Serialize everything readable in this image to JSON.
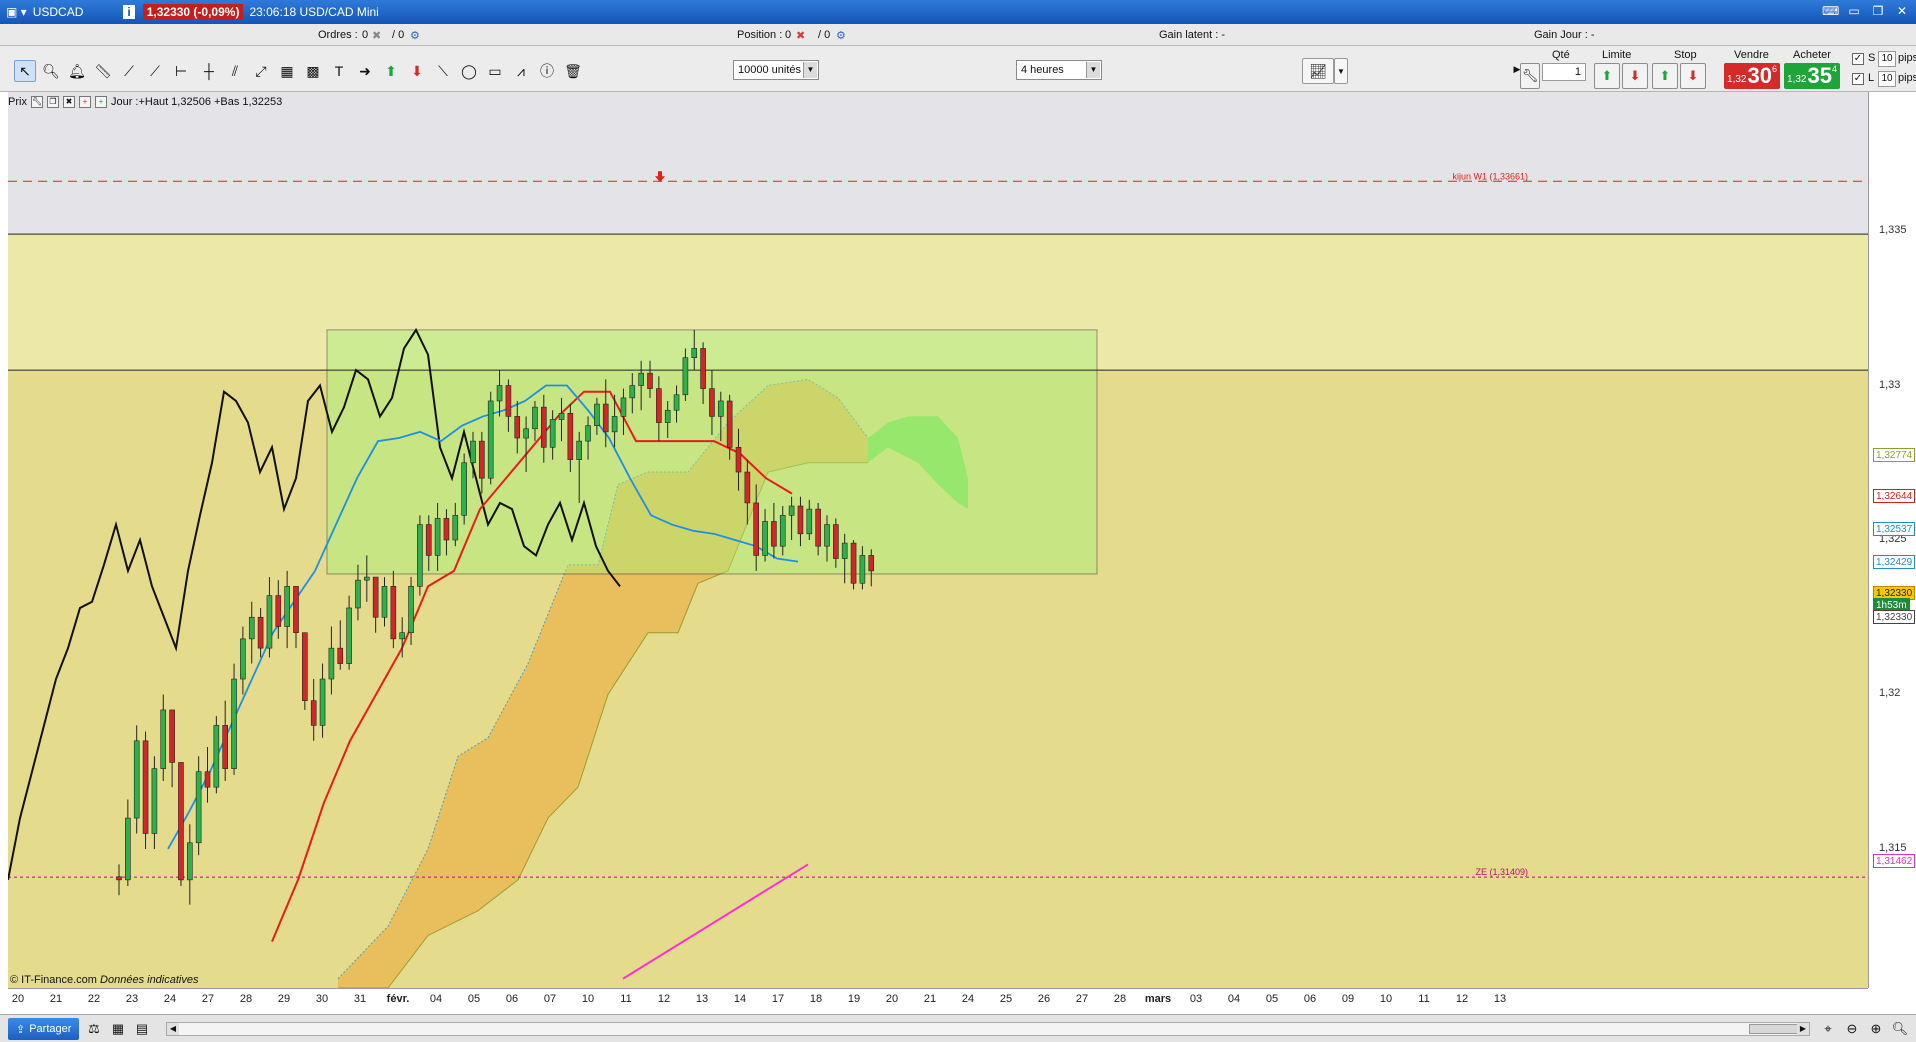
{
  "window": {
    "symbol": "USDCAD",
    "info_icon": "i",
    "price_change": "1,32330 (-0,09%)",
    "time_title": "23:06:18 USD/CAD Mini"
  },
  "infobar": {
    "ordres_label": "Ordres :",
    "ordres_value": "0",
    "ordres_total": "/ 0",
    "position_label": "Position :",
    "position_value": "0",
    "position_total": "/ 0",
    "gain_latent": "Gain latent : -",
    "gain_jour": "Gain Jour : -"
  },
  "toolbar": {
    "units_select": "10000 unités",
    "period_select": "4 heures"
  },
  "trade": {
    "qte_label": "Qté",
    "qte_value": "1",
    "limite_label": "Limite",
    "stop_label": "Stop",
    "vendre_label": "Vendre",
    "acheter_label": "Acheter",
    "sell_small": "1,32",
    "sell_big": "30",
    "sell_sup": "6",
    "buy_small": "1,32",
    "buy_big": "35",
    "buy_sup": "4",
    "s_label": "S",
    "l_label": "L",
    "s_pips_value": "10",
    "l_pips_value": "10",
    "pips_label": "pips",
    "sell_color": "#d42a2a",
    "buy_color": "#1ea53a"
  },
  "legend": {
    "prix": "Prix",
    "jour": "Jour :+Haut 1,32506 +Bas 1,32253"
  },
  "copyright": "© IT-Finance.com",
  "copyright_note": "Données indicatives",
  "annotations": {
    "kijun": "kijun W1 (1,33661)",
    "ze": "ZE (1,31409)"
  },
  "price_axis": {
    "ticks": [
      "1,335",
      "1,33",
      "1,325",
      "1,32",
      "1,315"
    ],
    "labels": [
      {
        "text": "1,32774",
        "color": "#8aa030"
      },
      {
        "text": "1,32644",
        "color": "#d42020"
      },
      {
        "text": "1,32537",
        "color": "#1e90d0"
      },
      {
        "text": "1,32429",
        "color": "#1e90d0"
      },
      {
        "text": "1,32330",
        "color": "#c08a00"
      },
      {
        "text": "1h53m",
        "color": "#1e8a3a"
      },
      {
        "text": "1,32330",
        "color": "#444444"
      },
      {
        "text": "1,31462",
        "color": "#e030c0"
      }
    ]
  },
  "date_axis": {
    "ticks": [
      "20",
      "21",
      "22",
      "23",
      "24",
      "27",
      "28",
      "29",
      "30",
      "31",
      "févr.",
      "04",
      "05",
      "06",
      "07",
      "10",
      "11",
      "12",
      "13",
      "14",
      "17",
      "18",
      "19",
      "20",
      "21",
      "24",
      "25",
      "26",
      "27",
      "28",
      "mars",
      "03",
      "04",
      "05",
      "06",
      "09",
      "10",
      "11",
      "12",
      "13"
    ]
  },
  "bottombar": {
    "share": "Partager"
  },
  "chart_data": {
    "type": "candlestick",
    "instrument": "USD/CAD",
    "timeframe": "4 heures",
    "ylim": [
      1.3105,
      1.3395
    ],
    "price_ticks": [
      1.335,
      1.33,
      1.325,
      1.32,
      1.315
    ],
    "levels": [
      {
        "name": "kijun W1",
        "value": 1.33661
      },
      {
        "name": "ZE",
        "value": 1.31409
      },
      {
        "name": "line",
        "value": 1.3349
      },
      {
        "name": "line",
        "value": 1.3305
      }
    ],
    "candles": [
      [
        1.3141,
        1.3145,
        1.3135,
        1.314
      ],
      [
        1.314,
        1.3166,
        1.3138,
        1.316
      ],
      [
        1.316,
        1.319,
        1.3155,
        1.3185
      ],
      [
        1.3185,
        1.3188,
        1.315,
        1.3155
      ],
      [
        1.3155,
        1.318,
        1.315,
        1.3176
      ],
      [
        1.3176,
        1.32,
        1.3172,
        1.3195
      ],
      [
        1.3195,
        1.3192,
        1.317,
        1.3178
      ],
      [
        1.3178,
        1.3165,
        1.3138,
        1.314
      ],
      [
        1.314,
        1.3158,
        1.3132,
        1.3152
      ],
      [
        1.3152,
        1.318,
        1.3148,
        1.3175
      ],
      [
        1.3175,
        1.3183,
        1.3165,
        1.317
      ],
      [
        1.317,
        1.3193,
        1.3168,
        1.319
      ],
      [
        1.319,
        1.3198,
        1.3172,
        1.3176
      ],
      [
        1.3176,
        1.321,
        1.3174,
        1.3205
      ],
      [
        1.3205,
        1.3222,
        1.32,
        1.3218
      ],
      [
        1.3218,
        1.323,
        1.321,
        1.3225
      ],
      [
        1.3225,
        1.3228,
        1.3212,
        1.3215
      ],
      [
        1.3215,
        1.3238,
        1.3212,
        1.3232
      ],
      [
        1.3232,
        1.3237,
        1.3218,
        1.3222
      ],
      [
        1.3222,
        1.324,
        1.3215,
        1.3235
      ],
      [
        1.3235,
        1.3232,
        1.3215,
        1.322
      ],
      [
        1.322,
        1.3218,
        1.3195,
        1.3198
      ],
      [
        1.3198,
        1.3205,
        1.3185,
        1.319
      ],
      [
        1.319,
        1.321,
        1.3186,
        1.3205
      ],
      [
        1.3205,
        1.3222,
        1.32,
        1.3215
      ],
      [
        1.3215,
        1.3224,
        1.3208,
        1.321
      ],
      [
        1.321,
        1.3232,
        1.3208,
        1.3228
      ],
      [
        1.3228,
        1.3242,
        1.3224,
        1.3237
      ],
      [
        1.3237,
        1.3245,
        1.323,
        1.3238
      ],
      [
        1.3238,
        1.3236,
        1.322,
        1.3225
      ],
      [
        1.3225,
        1.3238,
        1.3222,
        1.3235
      ],
      [
        1.3235,
        1.324,
        1.3215,
        1.3218
      ],
      [
        1.3218,
        1.3225,
        1.3212,
        1.322
      ],
      [
        1.322,
        1.3238,
        1.3216,
        1.3235
      ],
      [
        1.3235,
        1.3258,
        1.3232,
        1.3255
      ],
      [
        1.3255,
        1.3258,
        1.324,
        1.3245
      ],
      [
        1.3245,
        1.3262,
        1.324,
        1.3257
      ],
      [
        1.3257,
        1.326,
        1.3245,
        1.325
      ],
      [
        1.325,
        1.3262,
        1.3248,
        1.3258
      ],
      [
        1.3258,
        1.3278,
        1.3255,
        1.3275
      ],
      [
        1.3275,
        1.3285,
        1.327,
        1.3282
      ],
      [
        1.3282,
        1.3285,
        1.3265,
        1.327
      ],
      [
        1.327,
        1.3298,
        1.3268,
        1.3295
      ],
      [
        1.3295,
        1.3305,
        1.329,
        1.33
      ],
      [
        1.33,
        1.3302,
        1.3285,
        1.329
      ],
      [
        1.329,
        1.3295,
        1.3278,
        1.3283
      ],
      [
        1.3283,
        1.329,
        1.3272,
        1.3286
      ],
      [
        1.3286,
        1.3295,
        1.3282,
        1.3293
      ],
      [
        1.3293,
        1.3297,
        1.3275,
        1.328
      ],
      [
        1.328,
        1.3292,
        1.3276,
        1.3289
      ],
      [
        1.3289,
        1.3296,
        1.3282,
        1.3291
      ],
      [
        1.3291,
        1.3294,
        1.3272,
        1.3276
      ],
      [
        1.3276,
        1.3285,
        1.3262,
        1.3282
      ],
      [
        1.3282,
        1.329,
        1.3276,
        1.3287
      ],
      [
        1.3287,
        1.3296,
        1.3284,
        1.3294
      ],
      [
        1.3294,
        1.3302,
        1.328,
        1.3285
      ],
      [
        1.3285,
        1.3297,
        1.328,
        1.329
      ],
      [
        1.329,
        1.3299,
        1.3284,
        1.3296
      ],
      [
        1.3296,
        1.3304,
        1.3291,
        1.33
      ],
      [
        1.33,
        1.3308,
        1.3292,
        1.3304
      ],
      [
        1.3304,
        1.3308,
        1.3296,
        1.3299
      ],
      [
        1.3299,
        1.3303,
        1.3282,
        1.3288
      ],
      [
        1.3288,
        1.3295,
        1.3283,
        1.3292
      ],
      [
        1.3292,
        1.33,
        1.3288,
        1.3297
      ],
      [
        1.3297,
        1.3312,
        1.3295,
        1.3309
      ],
      [
        1.3309,
        1.3318,
        1.3305,
        1.3312
      ],
      [
        1.3312,
        1.3314,
        1.3294,
        1.3299
      ],
      [
        1.3299,
        1.3305,
        1.3284,
        1.329
      ],
      [
        1.329,
        1.3298,
        1.3282,
        1.3295
      ],
      [
        1.3295,
        1.3297,
        1.3276,
        1.328
      ],
      [
        1.328,
        1.3286,
        1.3266,
        1.3272
      ],
      [
        1.3272,
        1.3276,
        1.3255,
        1.3262
      ],
      [
        1.3262,
        1.3268,
        1.324,
        1.3245
      ],
      [
        1.3245,
        1.326,
        1.3243,
        1.3256
      ],
      [
        1.3256,
        1.3262,
        1.3244,
        1.3248
      ],
      [
        1.3248,
        1.3261,
        1.3245,
        1.3258
      ],
      [
        1.3258,
        1.3264,
        1.325,
        1.3261
      ],
      [
        1.3261,
        1.3264,
        1.3248,
        1.3252
      ],
      [
        1.3252,
        1.3263,
        1.325,
        1.326
      ],
      [
        1.326,
        1.3262,
        1.3245,
        1.3248
      ],
      [
        1.3248,
        1.3258,
        1.3243,
        1.3255
      ],
      [
        1.3255,
        1.3257,
        1.3241,
        1.3244
      ],
      [
        1.3244,
        1.3252,
        1.3236,
        1.3249
      ],
      [
        1.3249,
        1.325,
        1.3234,
        1.3236
      ],
      [
        1.3236,
        1.3248,
        1.3234,
        1.3245
      ],
      [
        1.3245,
        1.3247,
        1.3235,
        1.324
      ]
    ],
    "chikou": [
      1.314,
      1.316,
      1.3175,
      1.319,
      1.3205,
      1.3215,
      1.3228,
      1.323,
      1.3242,
      1.3255,
      1.324,
      1.325,
      1.3235,
      1.3225,
      1.3215,
      1.324,
      1.3258,
      1.3275,
      1.3298,
      1.3295,
      1.3288,
      1.3272,
      1.328,
      1.326,
      1.327,
      1.3295,
      1.33,
      1.3285,
      1.3293,
      1.3305,
      1.3302,
      1.329,
      1.3296,
      1.3312,
      1.3318,
      1.331,
      1.328,
      1.327,
      1.3285,
      1.327,
      1.3255,
      1.3262,
      1.326,
      1.3248,
      1.3245,
      1.3255,
      1.3262,
      1.325,
      1.3262,
      1.3248,
      1.324,
      1.3235
    ],
    "tenkan": [
      1.315,
      1.3162,
      1.3175,
      1.319,
      1.3205,
      1.322,
      1.323,
      1.324,
      1.3255,
      1.327,
      1.3282,
      1.3283,
      1.3285,
      1.3282,
      1.3287,
      1.329,
      1.3292,
      1.3295,
      1.33,
      1.33,
      1.3292,
      1.3283,
      1.327,
      1.3258,
      1.3255,
      1.3253,
      1.3252,
      1.325,
      1.3248,
      1.3244,
      1.3243
    ],
    "kijun": [
      1.312,
      1.314,
      1.3165,
      1.3185,
      1.32,
      1.3215,
      1.3235,
      1.324,
      1.326,
      1.327,
      1.328,
      1.329,
      1.3298,
      1.3298,
      1.3282,
      1.3282,
      1.3282,
      1.3282,
      1.3278,
      1.327,
      1.3265
    ],
    "cloud_color_bull": "#7de05a",
    "cloud_color_bear": "#e8b850",
    "box": {
      "top": 1.3318,
      "bottom": 1.3239
    }
  }
}
